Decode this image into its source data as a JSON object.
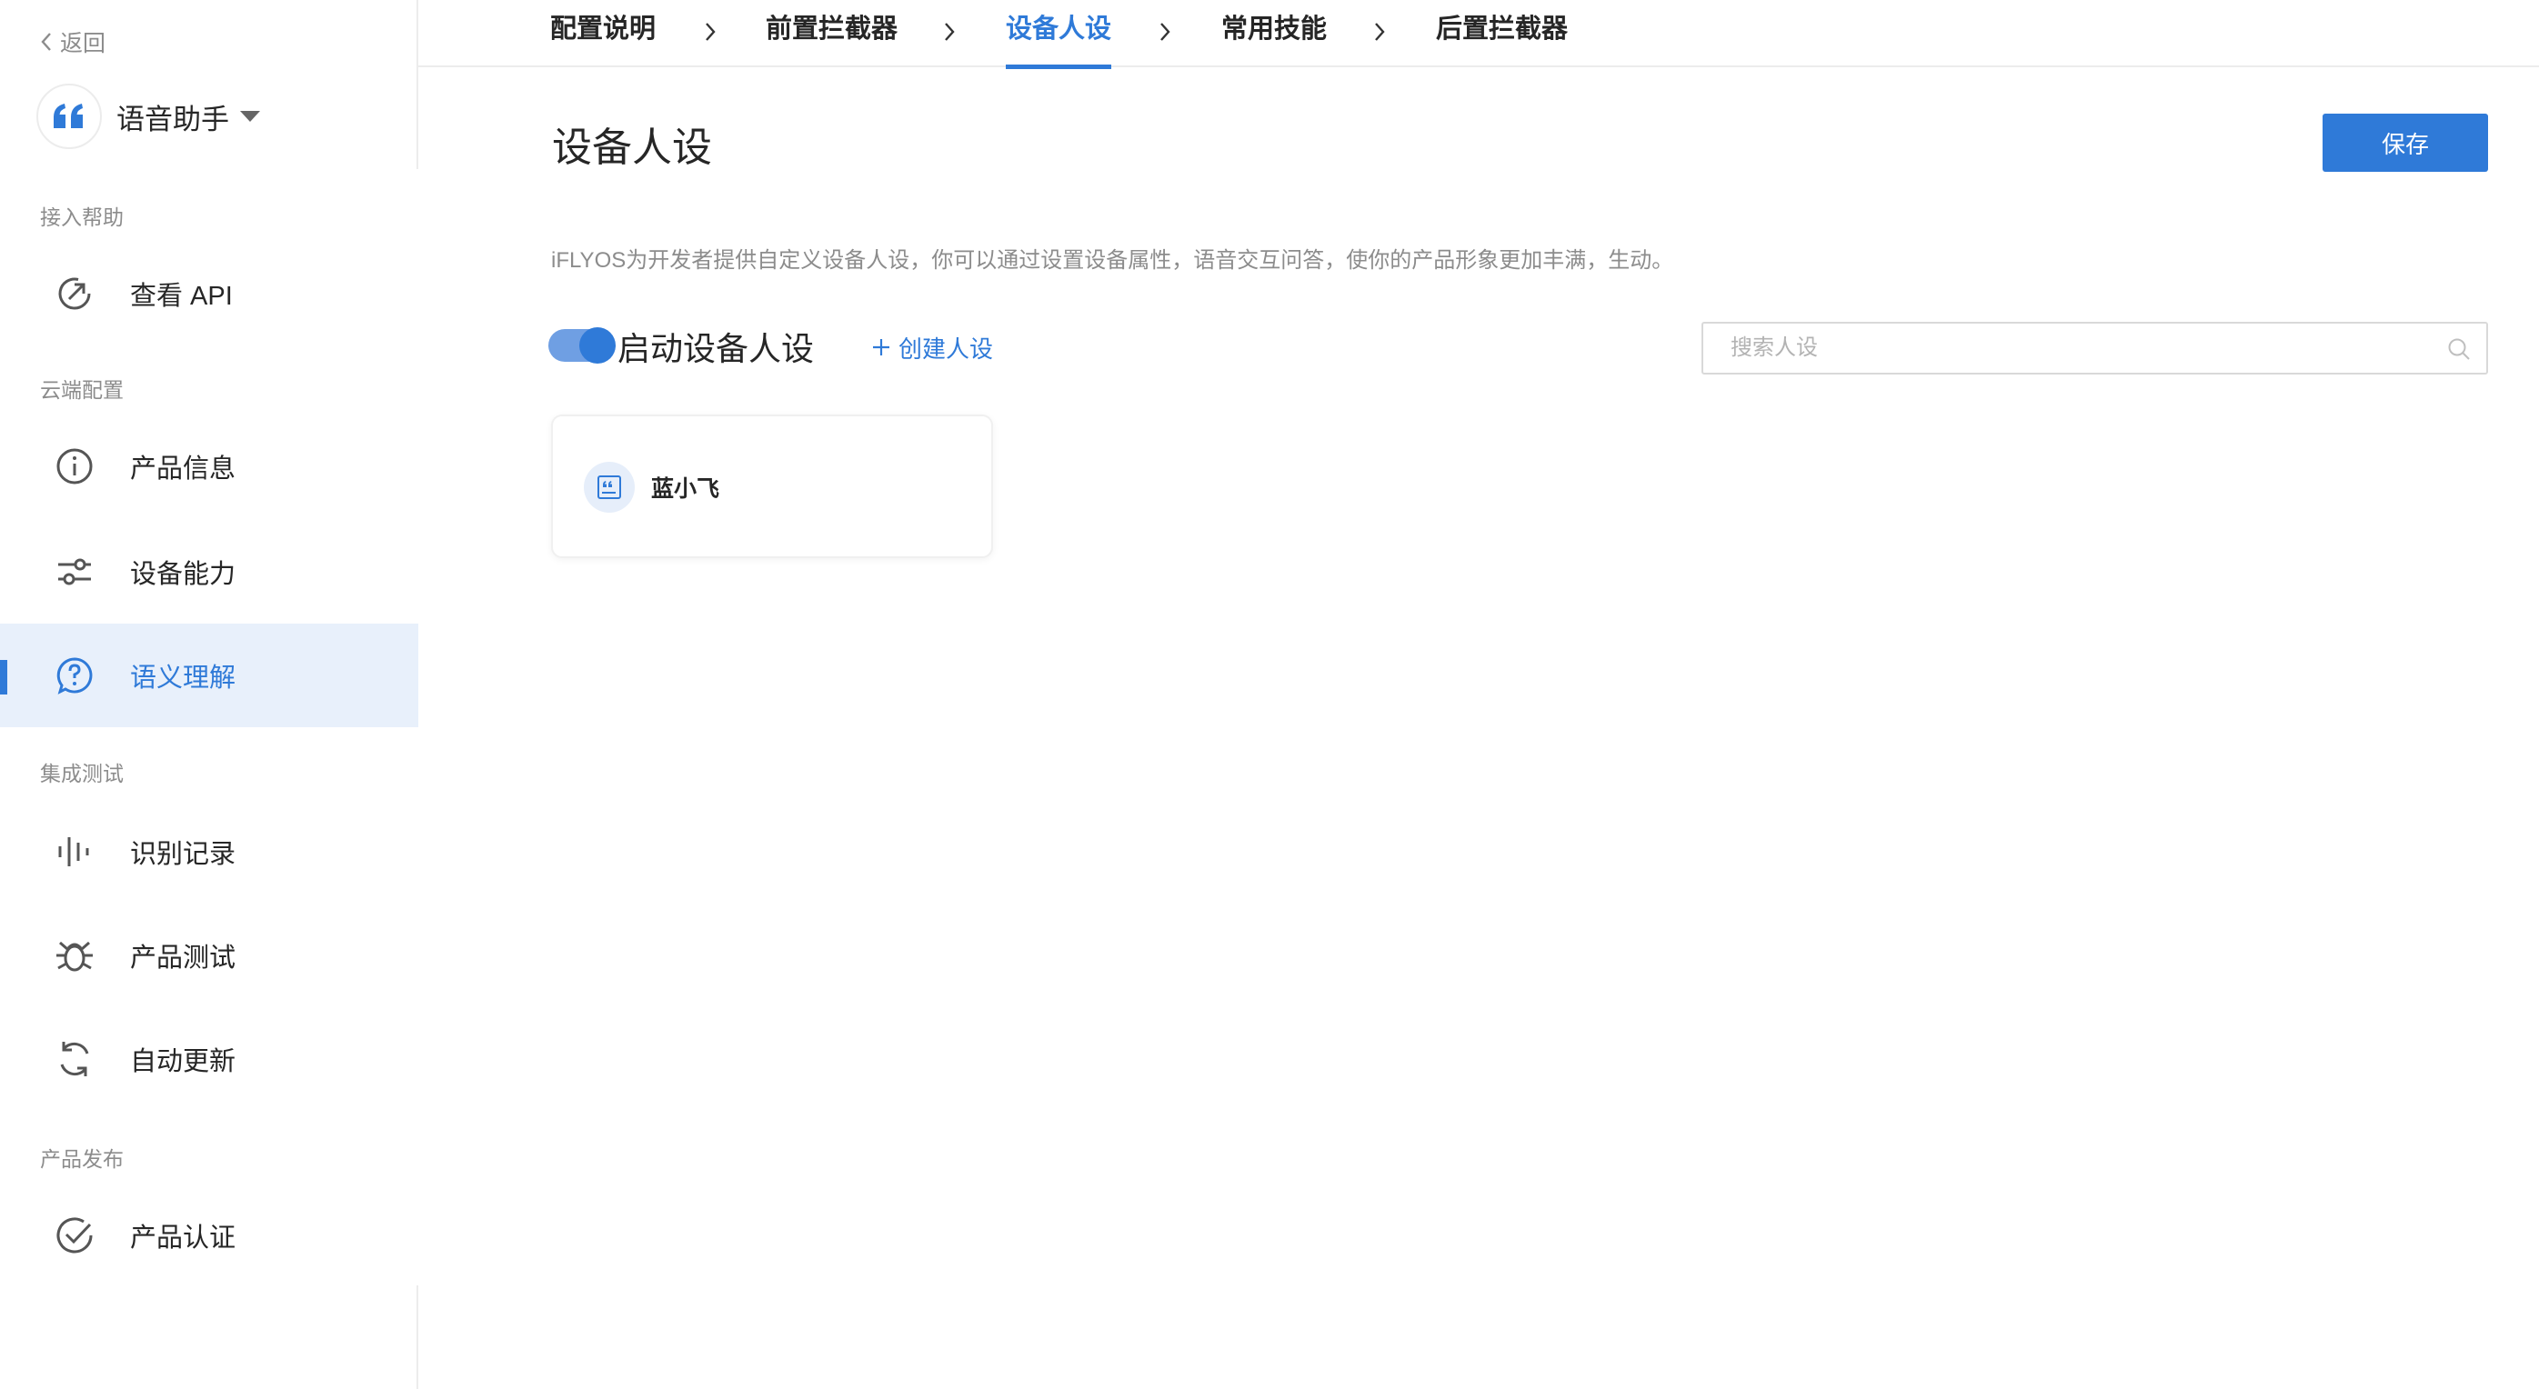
{
  "sidebar": {
    "back_label": "返回",
    "app_name": "语音助手",
    "sections": [
      {
        "label": "接入帮助"
      },
      {
        "label": "云端配置"
      },
      {
        "label": "集成测试"
      },
      {
        "label": "产品发布"
      }
    ],
    "items": [
      {
        "label": "查看 API",
        "icon": "external-link-icon"
      },
      {
        "label": "产品信息",
        "icon": "info-icon"
      },
      {
        "label": "设备能力",
        "icon": "sliders-icon"
      },
      {
        "label": "语义理解",
        "icon": "question-bubble-icon",
        "active": true
      },
      {
        "label": "识别记录",
        "icon": "waveform-icon"
      },
      {
        "label": "产品测试",
        "icon": "bug-icon"
      },
      {
        "label": "自动更新",
        "icon": "refresh-icon"
      },
      {
        "label": "产品认证",
        "icon": "check-circle-icon"
      }
    ]
  },
  "steps": [
    {
      "label": "配置说明"
    },
    {
      "label": "前置拦截器"
    },
    {
      "label": "设备人设",
      "active": true
    },
    {
      "label": "常用技能"
    },
    {
      "label": "后置拦截器"
    }
  ],
  "main": {
    "title": "设备人设",
    "save_label": "保存",
    "description": "iFLYOS为开发者提供自定义设备人设，你可以通过设置设备属性，语音交互问答，使你的产品形象更加丰满，生动。",
    "toggle_label": "启动设备人设",
    "toggle_on": true,
    "create_label": "创建人设",
    "search_placeholder": "搜索人设",
    "search_value": "",
    "personas": [
      {
        "name": "蓝小飞"
      }
    ]
  },
  "colors": {
    "accent": "#2f7ad8",
    "active_bg": "#e8f0fb",
    "muted_text": "#8c8c8c",
    "border": "#ececec"
  }
}
